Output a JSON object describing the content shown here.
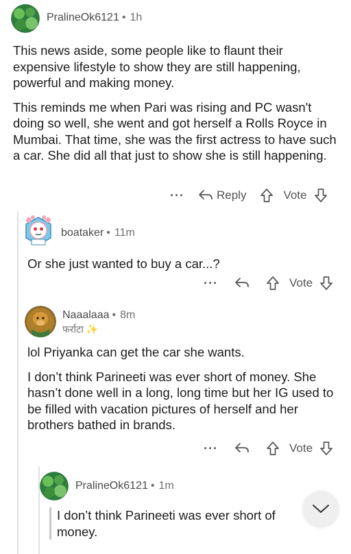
{
  "comments": [
    {
      "username": "PralineOk6121",
      "time": "1h",
      "paragraphs": [
        "This news aside, some people like to flaunt their expensive lifestyle to show they are still happening, powerful and making money.",
        "This reminds me when Pari was rising and PC wasn't doing so well, she went and got herself a Rolls Royce in Mumbai. That time, she was the first actress to have such a car. She did all that just to show she is still happening."
      ],
      "reply_label": "Reply",
      "vote_label": "Vote",
      "more_label": "···"
    },
    {
      "username": "boataker",
      "time": "11m",
      "paragraphs": [
        "Or she just wanted to buy a car...?"
      ],
      "vote_label": "Vote",
      "more_label": "···"
    },
    {
      "username": "Naaalaaa",
      "time": "8m",
      "flair": "फर्राटा ✨",
      "paragraphs": [
        "lol  Priyanka can get the car she wants.",
        "I don’t think Parineeti was ever short of money. She hasn’t done well in a long, long time but her IG used to be filled with vacation pictures of herself and her brothers bathed in brands."
      ],
      "vote_label": "Vote",
      "more_label": "···"
    },
    {
      "username": "PralineOk6121",
      "time": "1m",
      "quote": "I don’t think Parineeti was ever short of money."
    }
  ],
  "icons": {
    "reply": "reply-arrow-icon",
    "upvote": "upvote-arrow-icon",
    "downvote": "downvote-arrow-icon",
    "scroll": "chevron-down-icon"
  },
  "colors": {
    "avatar_green": "#2e7d3f",
    "avatar_light_green": "#6bbf59",
    "text": "#1c1c1c",
    "muted": "#6f6f6f"
  }
}
